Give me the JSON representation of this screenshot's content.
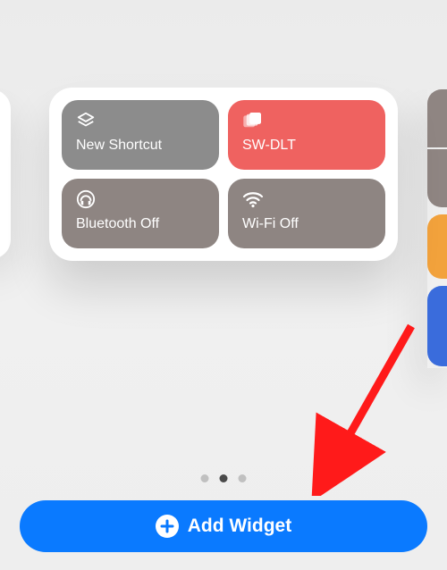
{
  "widget": {
    "tiles": [
      {
        "label": "New Shortcut",
        "icon": "stack-icon",
        "color": "gray1"
      },
      {
        "label": "SW-DLT",
        "icon": "cards-icon",
        "color": "red"
      },
      {
        "label": "Bluetooth Off",
        "icon": "headphones-icon",
        "color": "gray2"
      },
      {
        "label": "Wi-Fi Off",
        "icon": "wifi-icon",
        "color": "gray3"
      }
    ]
  },
  "pagination": {
    "total": 3,
    "active_index": 1
  },
  "add_button": {
    "label": "Add Widget"
  }
}
